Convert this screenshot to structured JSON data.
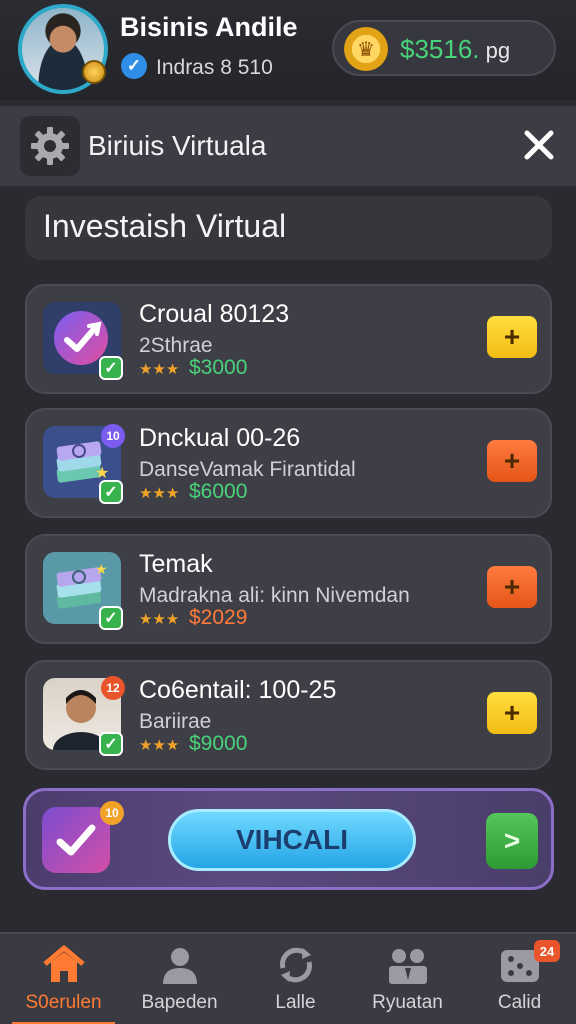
{
  "header": {
    "user_name": "Bisinis Andile",
    "user_subtitle": "Indras 8 510",
    "balance": "$3516.",
    "balance_unit": " pg"
  },
  "titlebar": {
    "title": "Biriuis Virtuala"
  },
  "section": {
    "title": "Investaish Virtual"
  },
  "items": [
    {
      "title": "Croual 80123",
      "subtitle": "2Sthrae",
      "stars": "★★★",
      "price": "$3000",
      "price_color": "#49d27a",
      "button": "+",
      "button_color": "yellow",
      "icon": "checkmark-arrow-icon"
    },
    {
      "title": "Dnckual 00-26",
      "subtitle": "DanseVamak Firantidal",
      "stars": "★★★",
      "price": "$6000",
      "price_color": "#49d27a",
      "button": "+",
      "button_color": "orange",
      "badge": "10",
      "icon": "money-stack-icon"
    },
    {
      "title": "Temak",
      "subtitle": "Madrakna ali: kinn Nivemdan",
      "stars": "★★★",
      "price": "$2029",
      "price_color": "#ff7a3a",
      "button": "+",
      "button_color": "orange",
      "icon": "money-stack-icon"
    },
    {
      "title": "Co6entail: 100-25",
      "subtitle": "Bariirae",
      "stars": "★★★",
      "price": "$9000",
      "price_color": "#49d27a",
      "button": "+",
      "button_color": "yellow",
      "badge": "12",
      "icon": "person-photo-icon"
    }
  ],
  "action": {
    "badge": "10",
    "button_label": "VIHCALI",
    "go_label": ">"
  },
  "nav": [
    {
      "label": "S0erulen",
      "icon": "home-icon",
      "active": true
    },
    {
      "label": "Bapeden",
      "icon": "person-icon"
    },
    {
      "label": "Lalle",
      "icon": "refresh-icon"
    },
    {
      "label": "Ryuatan",
      "icon": "people-icon"
    },
    {
      "label": "Calid",
      "icon": "dice-icon",
      "badge": "24"
    }
  ]
}
